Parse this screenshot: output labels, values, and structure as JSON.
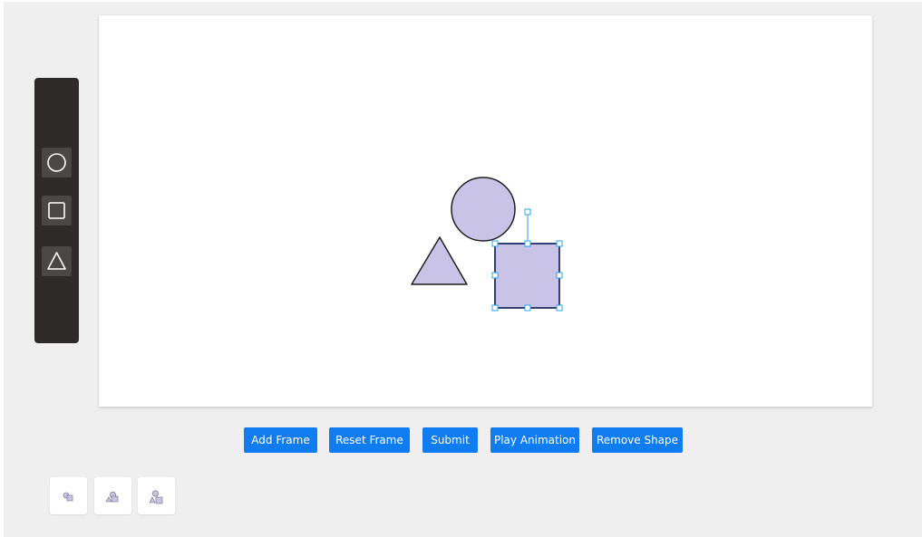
{
  "colors": {
    "app_background": "#efefef",
    "toolbar_background": "#2d2a29",
    "tool_button_background": "#4a4746",
    "canvas_background": "#ffffff",
    "shape_fill": "#c9c3e8",
    "shape_stroke": "#1f1f1f",
    "selection_handle": "#29a3e6",
    "accent_button": "#0f7cf2"
  },
  "toolbar": {
    "tools": [
      {
        "name": "circle-tool",
        "icon": "circle-icon"
      },
      {
        "name": "square-tool",
        "icon": "square-icon"
      },
      {
        "name": "triangle-tool",
        "icon": "triangle-icon"
      }
    ]
  },
  "canvas": {
    "shapes": [
      {
        "type": "circle",
        "selected": false
      },
      {
        "type": "triangle",
        "selected": false
      },
      {
        "type": "square",
        "selected": true
      }
    ]
  },
  "actions": {
    "add_frame": "Add Frame",
    "reset_frame": "Reset Frame",
    "submit": "Submit",
    "play_animation": "Play Animation",
    "remove_shape": "Remove Shape"
  },
  "frames": {
    "count": 3
  }
}
